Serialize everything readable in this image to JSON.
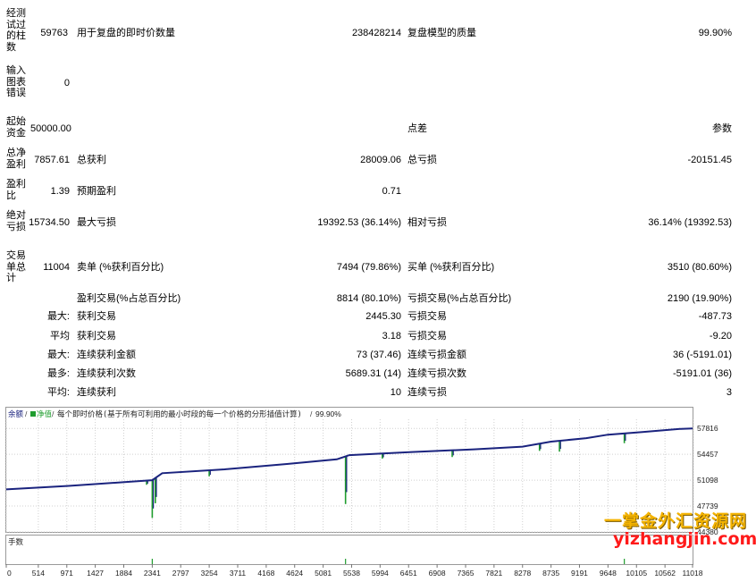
{
  "report": {
    "bars_tested": {
      "label": "经测试过的柱数",
      "value": "59763"
    },
    "ticks_modelled": {
      "label": "用于复盘的即时价数量",
      "value": "238428214"
    },
    "modelling_quality": {
      "label": "复盘模型的质量",
      "value": "99.90%"
    },
    "chart_errors": {
      "label": "输入图表错误",
      "value": "0"
    },
    "initial_deposit": {
      "label": "起始资金",
      "value": "50000.00"
    },
    "spread": {
      "label": "点差",
      "value": "参数"
    },
    "net_profit": {
      "label": "总净盈利",
      "value": "7857.61"
    },
    "gross_profit": {
      "label": "总获利",
      "value": "28009.06"
    },
    "gross_loss": {
      "label": "总亏损",
      "value": "-20151.45"
    },
    "profit_factor": {
      "label": "盈利比",
      "value": "1.39"
    },
    "expected_payoff": {
      "label": "预期盈利",
      "value": "0.71"
    },
    "absolute_drawdown": {
      "label": "绝对亏损",
      "value": "15734.50"
    },
    "maximal_drawdown": {
      "label": "最大亏损",
      "value": "19392.53 (36.14%)"
    },
    "relative_drawdown": {
      "label": "相对亏损",
      "value": "36.14% (19392.53)"
    },
    "total_trades": {
      "label": "交易单总计",
      "value": "11004"
    },
    "short_positions": {
      "label": "卖单 (%获利百分比)",
      "value": "7494 (79.86%)"
    },
    "long_positions": {
      "label": "买单 (%获利百分比)",
      "value": "3510 (80.60%)"
    },
    "profit_trades": {
      "label": "盈利交易(%占总百分比)",
      "value": "8814 (80.10%)"
    },
    "loss_trades": {
      "label": "亏损交易(%占总百分比)",
      "value": "2190 (19.90%)"
    },
    "largest": {
      "label": "最大:",
      "profit_label": "获利交易",
      "profit_value": "2445.30",
      "loss_label": "亏损交易",
      "loss_value": "-487.73"
    },
    "average": {
      "label": "平均",
      "profit_label": "获利交易",
      "profit_value": "3.18",
      "loss_label": "亏损交易",
      "loss_value": "-9.20"
    },
    "max_consecutive": {
      "label": "最大:",
      "wins_label": "连续获利金额",
      "wins_value": "73 (37.46)",
      "losses_label": "连续亏损金额",
      "losses_value": "36 (-5191.01)"
    },
    "maximal_consecutive": {
      "label": "最多:",
      "profit_label": "连续获利次数",
      "profit_value": "5689.31 (14)",
      "loss_label": "连续亏损次数",
      "loss_value": "-5191.01 (36)"
    },
    "avg_consecutive": {
      "label": "平均:",
      "wins_label": "连续获利",
      "wins_value": "10",
      "losses_label": "连续亏损",
      "losses_value": "3"
    }
  },
  "chart_data": {
    "type": "line",
    "header": {
      "balance_label": "余额",
      "equity_label": "净值",
      "description": "每个即时价格(基于所有可利用的最小时段的每一个价格的分形插值计算)",
      "quality": "99.90%"
    },
    "volume_label": "手数",
    "colors": {
      "balance": "#1a237e",
      "equity": "#1f9d2e"
    },
    "x_ticks": [
      "0",
      "514",
      "971",
      "1427",
      "1884",
      "2341",
      "2797",
      "3254",
      "3711",
      "4168",
      "4624",
      "5081",
      "5538",
      "5994",
      "6451",
      "6908",
      "7365",
      "7821",
      "8278",
      "8735",
      "9191",
      "9648",
      "10105",
      "10562",
      "11018"
    ],
    "y_ticks": [
      "57816",
      "54457",
      "51098",
      "47739",
      "44380"
    ],
    "ylim": [
      44380,
      59000
    ],
    "xlim": [
      0,
      11004
    ],
    "balance": {
      "x": [
        0,
        1000,
        2000,
        2341,
        2500,
        3500,
        4500,
        5300,
        5500,
        6500,
        7500,
        8278,
        8735,
        9300,
        9648,
        10200,
        10800,
        11004
      ],
      "y": [
        49900,
        50350,
        50900,
        51100,
        52000,
        52500,
        53200,
        53800,
        54350,
        54750,
        55100,
        55450,
        56100,
        56550,
        57000,
        57350,
        57750,
        57816
      ]
    },
    "equity_dips": [
      {
        "x": 2250,
        "y": 50500
      },
      {
        "x": 2341,
        "y": 46200
      },
      {
        "x": 2390,
        "y": 48100
      },
      {
        "x": 3254,
        "y": 51600
      },
      {
        "x": 5440,
        "y": 48000
      },
      {
        "x": 6030,
        "y": 53900
      },
      {
        "x": 7150,
        "y": 54100
      },
      {
        "x": 8550,
        "y": 54900
      },
      {
        "x": 8870,
        "y": 54800
      },
      {
        "x": 9910,
        "y": 55900
      }
    ]
  },
  "watermark": {
    "line1": "一掌金外汇资源网",
    "line2": "yizhangjin.com"
  }
}
